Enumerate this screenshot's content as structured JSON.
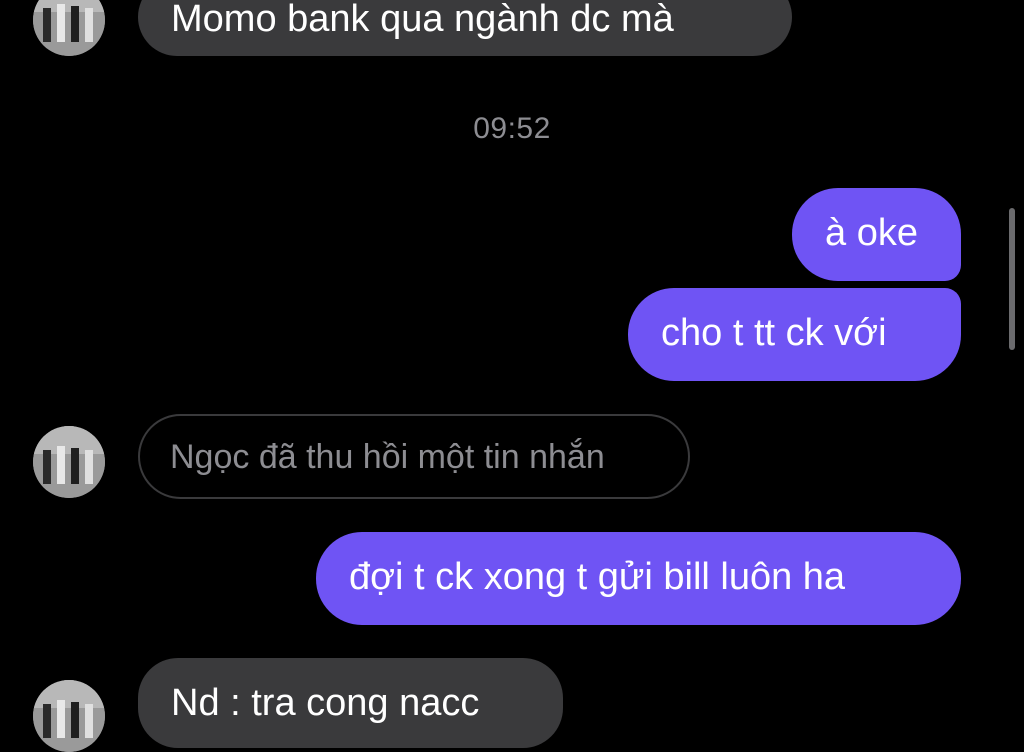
{
  "thread": {
    "contact_name": "Ngọc",
    "colors": {
      "incoming_bubble": "#3a3a3c",
      "outgoing_bubble": "#6f54f4",
      "background": "#000000",
      "muted_text": "#8d8d92"
    },
    "messages": [
      {
        "direction": "incoming",
        "text": "Momo bank qua ngành dc mà"
      },
      {
        "direction": "outgoing",
        "text": "à oke"
      },
      {
        "direction": "outgoing",
        "text": "cho t tt ck với"
      },
      {
        "direction": "incoming",
        "text": "Ngọc đã thu hồi một tin nhắn",
        "unsent": true
      },
      {
        "direction": "outgoing",
        "text": "đợi t ck xong t gửi bill luôn ha"
      },
      {
        "direction": "incoming",
        "text": "Nd : tra cong nacc"
      }
    ],
    "timestamp": "09:52"
  }
}
